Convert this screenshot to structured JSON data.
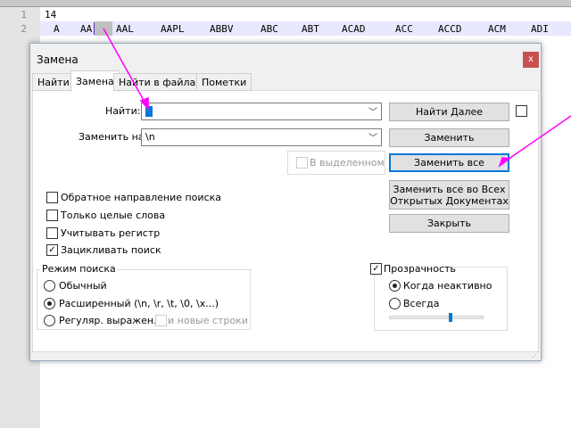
{
  "editor": {
    "lines": [
      {
        "num": "1",
        "text": "14"
      },
      {
        "num": "2",
        "tokens": [
          "A",
          "AA",
          "AAL",
          "AAPL",
          "ABBV",
          "ABC",
          "ABT",
          "ACAD",
          "ACC",
          "ACCD",
          "ACM",
          "ADI"
        ]
      }
    ]
  },
  "dialog": {
    "title": "Замена",
    "close": "x",
    "tabs": [
      "Найти",
      "Замена",
      "Найти в файлах",
      "Пометки"
    ],
    "find_label": "Найти:",
    "find_value": "",
    "replace_label": "Заменить на:",
    "replace_value": "\\n",
    "in_selection": "В выделенном",
    "buttons": {
      "find_next": "Найти Далее",
      "replace": "Заменить",
      "replace_all": "Заменить все",
      "replace_all_docs_1": "Заменить все во Всех",
      "replace_all_docs_2": "Открытых Документах",
      "close": "Закрыть"
    },
    "options": [
      {
        "label": "Обратное направление поиска",
        "checked": false
      },
      {
        "label": "Только целые слова",
        "checked": false
      },
      {
        "label": "Учитывать регистр",
        "checked": false
      },
      {
        "label": "Зацикливать поиск",
        "checked": true
      }
    ],
    "search_mode": {
      "title": "Режим поиска",
      "normal": "Обычный",
      "extended": "Расширенный (\\n, \\r, \\t, \\0, \\x...)",
      "regex": "Регуляр. выражен.",
      "newlines": "и новые строки"
    },
    "transparency": {
      "title": "Прозрачность",
      "on_inactive": "Когда неактивно",
      "always": "Всегда",
      "level": 0.65
    }
  },
  "colors": {
    "accent": "#0078d7",
    "arrow": "#ff00ff"
  }
}
